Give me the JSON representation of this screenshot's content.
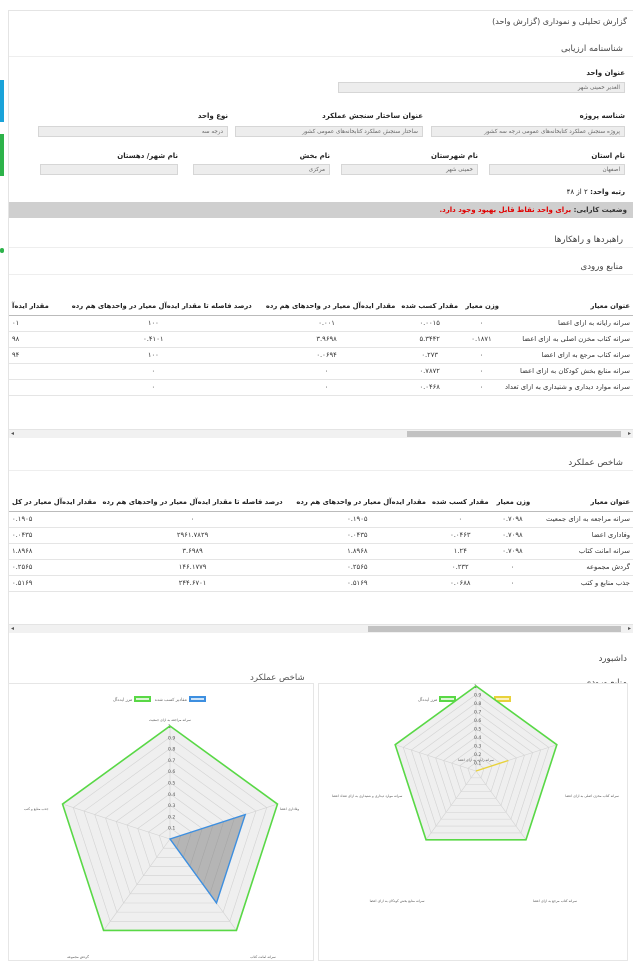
{
  "page_title": "گزارش تحلیلی و نموداری (گزارش واحد)",
  "identity": {
    "title": "شناسنامه ارزیابی",
    "unit_title_label": "عنوان واحد",
    "unit_title_value": "الغدیر خمینی شهر",
    "project_id_label": "شناسه پروژه",
    "project_id_value": "پروژه سنجش عملکرد کتابخانه‌های عمومی درجه سه کشور",
    "measure_structure_label": "عنوان ساختار سنجش عملکرد",
    "measure_structure_value": "ساختار سنجش عملکرد کتابخانه‌های عمومی کشور",
    "unit_type_label": "نوع واحد",
    "unit_type_value": "درجه سه",
    "province_label": "نام استان",
    "province_value": "اصفهان",
    "county_label": "نام شهرستان",
    "county_value": "خمینی شهر",
    "district_label": "نام بخش",
    "district_value": "مرکزی",
    "city_label": "نام شهر/ دهستان",
    "city_value": "",
    "rank_label": "رتبه واحد:",
    "rank_text": "۲ از ۴۸",
    "status_label": "وضعیت کارایی:",
    "status_value": "برای واحد نقاط قابل بهبود وجود دارد."
  },
  "guidelines_title": "راهبردها و راهکارها",
  "inputs_table": {
    "title": "منابع ورودی",
    "headers": [
      "عنوان معیار",
      "وزن معیار",
      "مقدار کسب شده",
      "مقدار ایده‌آل معیار در واحدهای هم رده",
      "درصد فاصله تا مقدار ایده‌آل معیار در واحدهای هم رده",
      "مقدار ایده‌آ"
    ],
    "rows": [
      [
        "سرانه رایانه به ازای اعضا",
        "۰",
        "۰.۰۰۱۵",
        "۰.۰۰۱",
        "۱۰۰",
        "۰۱"
      ],
      [
        "سرانه کتاب مخزن اصلی به ازای اعضا",
        "۰.۱۸۷۱",
        "۵.۳۴۴۲",
        "۳.۹۶۹۸",
        "۰.۴۱۰۱",
        "۹۸"
      ],
      [
        "سرانه کتاب مرجع به ازای اعضا",
        "۰",
        "۰.۲۷۳",
        "۰.۰۶۹۴",
        "۱۰۰",
        "۹۴"
      ],
      [
        "سرانه منابع بخش کودکان به ازای اعضا",
        "۰",
        "۰.۷۸۷۲",
        "۰",
        "۰",
        ""
      ],
      [
        "سرانه موارد دیداری و شنیداری به ازای تعداد",
        "۰",
        "۰.۰۴۶۸",
        "۰",
        "۰",
        ""
      ]
    ]
  },
  "performance_table": {
    "title": "شاخص عملکرد",
    "headers": [
      "عنوان معیار",
      "وزن معیار",
      "مقدار کسب شده",
      "مقدار ایده‌آل معیار در واحدهای هم رده",
      "درصد فاصله تا مقدار ایده‌آل معیار در واحدهای هم رده",
      "مقدار ایده‌آل معیار در کل"
    ],
    "rows": [
      [
        "سرانه مراجعه به ازای جمعیت",
        "۰.۷۰۹۸",
        "۰",
        "۰.۱۹۰۵",
        "۰",
        "۰.۱۹۰۵"
      ],
      [
        "وفاداری اعضا",
        "۰.۷۰۹۸",
        "۰.۰۴۶۳",
        "۰.۰۴۳۵",
        "۲۹۶۱.۷۸۲۹",
        "۰.۰۴۳۵"
      ],
      [
        "سرانه امانت کتاب",
        "۰.۷۰۹۸",
        "۱.۲۴",
        "۱.۸۹۶۸",
        "۳.۶۹۸۹",
        "۱.۸۹۶۸"
      ],
      [
        "گردش مجموعه",
        "۰",
        "۰.۲۳۲",
        "۰.۲۵۶۵",
        "۱۴۶.۱۷۷۹",
        "۰.۲۵۶۵"
      ],
      [
        "جذب منابع و کتب",
        "۰",
        "۰.۰۶۸۸",
        "۰.۵۱۶۹",
        "۲۴۴.۶۷۰۱",
        "۰.۵۱۶۹"
      ]
    ]
  },
  "dashboard_title": "داشبورد",
  "inputs_chart_section": "منابع ورودی",
  "colors": {
    "green": "#59d846",
    "blue": "#3d8fe0",
    "yellow": "#e8d23b",
    "red": "#e10000"
  },
  "chart_data": [
    {
      "type": "radar",
      "title": "",
      "axes": [
        "سرانه رایانه به ازای اعضا",
        "سرانه کتاب مخزن اصلی به ازای اعضا",
        "سرانه کتاب مرجع به ازای اعضا",
        "سرانه منابع بخش کودکان به ازای اعضا",
        "سرانه موارد دیداری و شنیداری به ازای تعداد اعضا"
      ],
      "ticks": [
        "0.1",
        "0.2",
        "0.3",
        "0.4",
        "0.5",
        "0.6",
        "0.7",
        "0.8",
        "0.9",
        "1"
      ],
      "range": [
        0,
        1
      ],
      "legend": "top",
      "series": [
        {
          "name": "مقادیر کسب شده",
          "color": "#e8d23b",
          "values": [
            0,
            0.4,
            0,
            0,
            0
          ]
        },
        {
          "name": "مرز ایده‌آل",
          "color": "#59d846",
          "values": [
            1,
            1,
            1,
            1,
            1
          ]
        }
      ]
    },
    {
      "type": "radar",
      "title": "شاخص عملکرد",
      "axes": [
        "سرانه مراجعه به ازای جمعیت",
        "وفاداری اعضا",
        "سرانه امانت کتاب",
        "گردش مجموعه",
        "جذب منابع و کتب"
      ],
      "ticks": [
        "0.1",
        "0.2",
        "0.3",
        "0.4",
        "0.5",
        "0.6",
        "0.7",
        "0.8",
        "0.9",
        "1"
      ],
      "range": [
        0,
        1
      ],
      "legend": "top",
      "series": [
        {
          "name": "مقادیر کسب شده",
          "color": "#3d8fe0",
          "values": [
            0,
            0.7,
            0.7,
            0,
            0
          ]
        },
        {
          "name": "مرز ایده‌آل",
          "color": "#59d846",
          "values": [
            1,
            1,
            1,
            1,
            1
          ]
        }
      ]
    }
  ]
}
